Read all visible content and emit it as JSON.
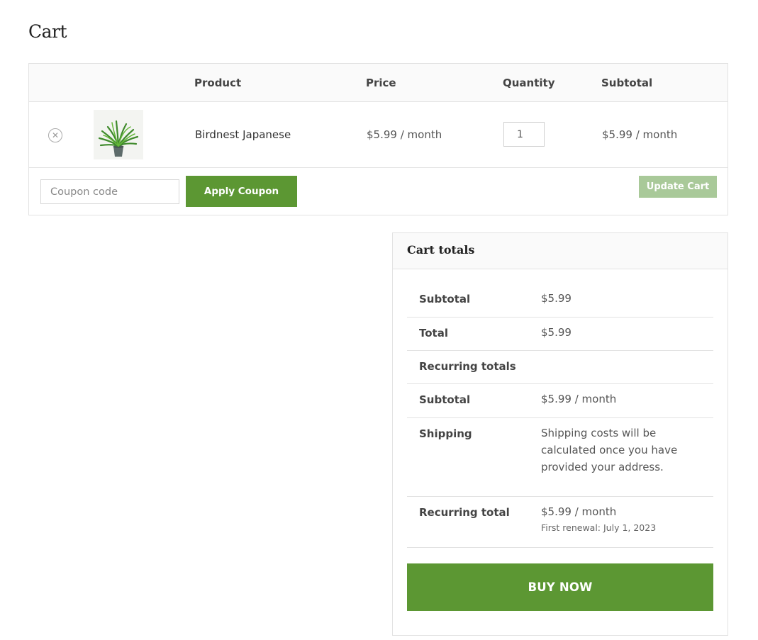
{
  "page": {
    "title": "Cart"
  },
  "table": {
    "headers": {
      "product": "Product",
      "price": "Price",
      "quantity": "Quantity",
      "subtotal": "Subtotal"
    },
    "item": {
      "remove_icon": "close-circle-icon",
      "thumbnail_icon": "potted-plant-icon",
      "name": "Birdnest Japanese",
      "price": "$5.99 / month",
      "quantity": "1",
      "subtotal": "$5.99 / month"
    }
  },
  "actions": {
    "coupon_placeholder": "Coupon code",
    "apply_label": "Apply Coupon",
    "update_label": "Update Cart"
  },
  "totals": {
    "title": "Cart totals",
    "subtotal_label": "Subtotal",
    "subtotal_value": "$5.99",
    "total_label": "Total",
    "total_value": "$5.99",
    "recurring_label": "Recurring totals",
    "recurring_subtotal_label": "Subtotal",
    "recurring_subtotal_value": "$5.99 / month",
    "shipping_label": "Shipping",
    "shipping_value": "Shipping costs will be calculated once you have provided your address.",
    "recurring_total_label": "Recurring total",
    "recurring_total_value": "$5.99 / month",
    "first_renewal": "First renewal: July 1, 2023",
    "buy_label": "BUY NOW"
  },
  "colors": {
    "accent": "#5c9733",
    "accent_disabled": "#a9c999",
    "border": "#e2e2e2",
    "header_bg": "#fafafa"
  }
}
